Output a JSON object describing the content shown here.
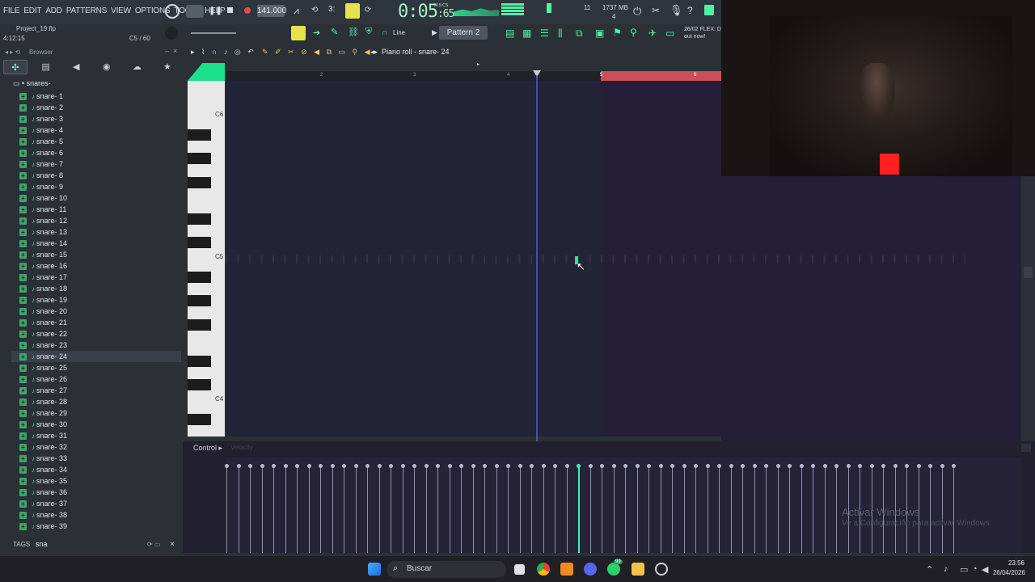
{
  "menu": [
    "FILE",
    "EDIT",
    "ADD",
    "PATTERNS",
    "VIEW",
    "OPTIONS",
    "TOOLS",
    "HELP"
  ],
  "transport": {
    "tempo": "141.000",
    "time_main": "0:05",
    "time_sub": ":65",
    "time_unit": "M:S:CS"
  },
  "meters": {
    "cpu": "11",
    "ram": "1737 MB",
    "poly": "4"
  },
  "project": {
    "name": "Project_19.flp",
    "time": "4:12:15",
    "note": "C5 / 60"
  },
  "snap_mode": "Line",
  "pattern": "Pattern 2",
  "news": {
    "date": "26/02",
    "line1": "FLEX: D",
    "line2": "out now!"
  },
  "browser": {
    "title": "Browser",
    "folder": "snares-",
    "files": [
      "snare- 1",
      "snare- 2",
      "snare- 3",
      "snare- 4",
      "snare- 5",
      "snare- 6",
      "snare- 7",
      "snare- 8",
      "snare- 9",
      "snare- 10",
      "snare- 11",
      "snare- 12",
      "snare- 13",
      "snare- 14",
      "snare- 15",
      "snare- 16",
      "snare- 17",
      "snare- 18",
      "snare- 19",
      "snare- 20",
      "snare- 21",
      "snare- 22",
      "snare- 23",
      "snare- 24",
      "snare- 25",
      "snare- 26",
      "snare- 27",
      "snare- 28",
      "snare- 29",
      "snare- 30",
      "snare- 31",
      "snare- 32",
      "snare- 33",
      "snare- 34",
      "snare- 35",
      "snare- 36",
      "snare- 37",
      "snare- 38",
      "snare- 39"
    ],
    "selected_index": 23,
    "tags_label": "TAGS",
    "tags_value": "sna"
  },
  "piano_roll": {
    "title": "Piano roll - ",
    "channel": "snare- 24",
    "ruler": [
      "2",
      "3",
      "4",
      "5",
      "6"
    ],
    "keys": [
      "C6",
      "C5",
      "C4"
    ]
  },
  "control": {
    "label": "Control",
    "param": "Velocity"
  },
  "windows": {
    "activate_title": "Activar Windows",
    "activate_sub": "Ve a Configuración para activar Windows."
  },
  "taskbar": {
    "search": "Buscar",
    "time": "23:56",
    "date": "26/04/2026",
    "badge": "99"
  },
  "colors": {
    "accent": "#27e79a",
    "playhead": "#5962d8",
    "ruler_red": "#c9505a"
  }
}
